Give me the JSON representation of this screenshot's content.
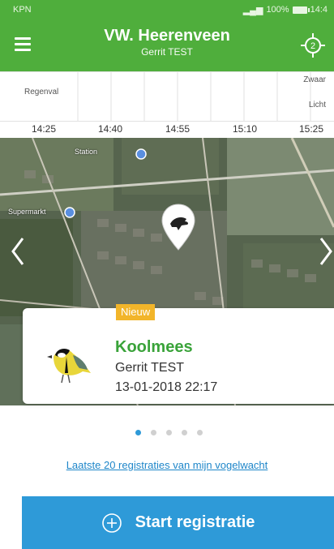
{
  "status_bar": {
    "carrier": "KPN",
    "battery_text": "100%",
    "clock": "14:4"
  },
  "header": {
    "title": "VW. Heerenveen",
    "subtitle": "Gerrit TEST",
    "locate_badge": "2",
    "menu_icon": "hamburger-menu-icon",
    "locate_icon": "crosshair-icon"
  },
  "weather": {
    "label_rain": "Regenval",
    "label_heavy": "Zwaar",
    "label_light": "Licht",
    "times": [
      "14:25",
      "14:40",
      "14:55",
      "15:10",
      "15:25"
    ]
  },
  "map": {
    "labels": [
      "Station",
      "Supermarkt"
    ],
    "pin_icon": "bird-location-pin-icon",
    "left_arrow_icon": "chevron-left-icon",
    "right_arrow_icon": "chevron-right-icon"
  },
  "card": {
    "badge": "Nieuw",
    "bird_name": "Koolmees",
    "observer": "Gerrit  TEST",
    "date": "13-01-2018 22:17",
    "image_icon": "great-tit-bird-image"
  },
  "pagination": {
    "count": 5,
    "active_index": 0
  },
  "links": {
    "recent": "Laatste 20 registraties van mijn vogelwacht"
  },
  "actions": {
    "start_label": "Start registratie",
    "start_icon": "plus-circle-icon"
  },
  "colors": {
    "header_green": "#4fae3c",
    "accent_blue": "#2e9ad8",
    "badge_yellow": "#f2b52a",
    "bird_name_green": "#3aa33a"
  }
}
